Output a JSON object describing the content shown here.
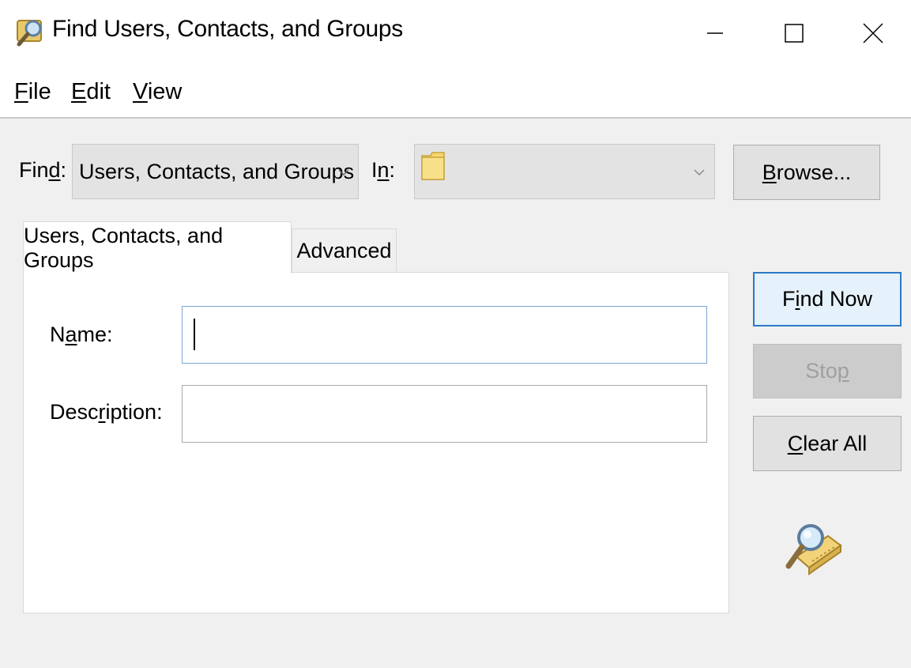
{
  "window": {
    "title": "Find Users, Contacts, and Groups",
    "icon": "find-magnifier-icon",
    "controls": [
      "minimize-icon",
      "maximize-icon",
      "close-icon"
    ]
  },
  "menu": {
    "file": {
      "pre": "",
      "key": "F",
      "rest": "ile"
    },
    "edit": {
      "pre": "",
      "key": "E",
      "rest": "dit"
    },
    "view": {
      "pre": "",
      "key": "V",
      "rest": "iew"
    }
  },
  "find": {
    "label": {
      "pre": "Fin",
      "key": "d",
      "rest": ":"
    },
    "value": "Users, Contacts, and Groups"
  },
  "in": {
    "label": {
      "pre": "I",
      "key": "n",
      "rest": ":"
    },
    "value": "",
    "icon": "folder-icon"
  },
  "buttons": {
    "browse": {
      "pre": "",
      "key": "B",
      "rest": "rowse..."
    },
    "find_now": {
      "pre": "F",
      "key": "i",
      "rest": "nd Now"
    },
    "stop": {
      "pre": "Sto",
      "key": "p",
      "rest": ""
    },
    "clear_all": {
      "pre": "",
      "key": "C",
      "rest": "lear All"
    }
  },
  "tabs": {
    "active": "Users, Contacts, and Groups",
    "advanced": "Advanced"
  },
  "fields": {
    "name": {
      "label": {
        "pre": "N",
        "key": "a",
        "rest": "me:"
      },
      "value": ""
    },
    "description": {
      "label": {
        "pre": "Desc",
        "key": "r",
        "rest": "iption:"
      },
      "value": ""
    }
  },
  "colors": {
    "accent": "#2b79c9",
    "window_bg": "#f0f0f0",
    "panel_bg": "#ffffff",
    "folder": "#f5d76e"
  },
  "decor_icon": "search-directory-icon"
}
